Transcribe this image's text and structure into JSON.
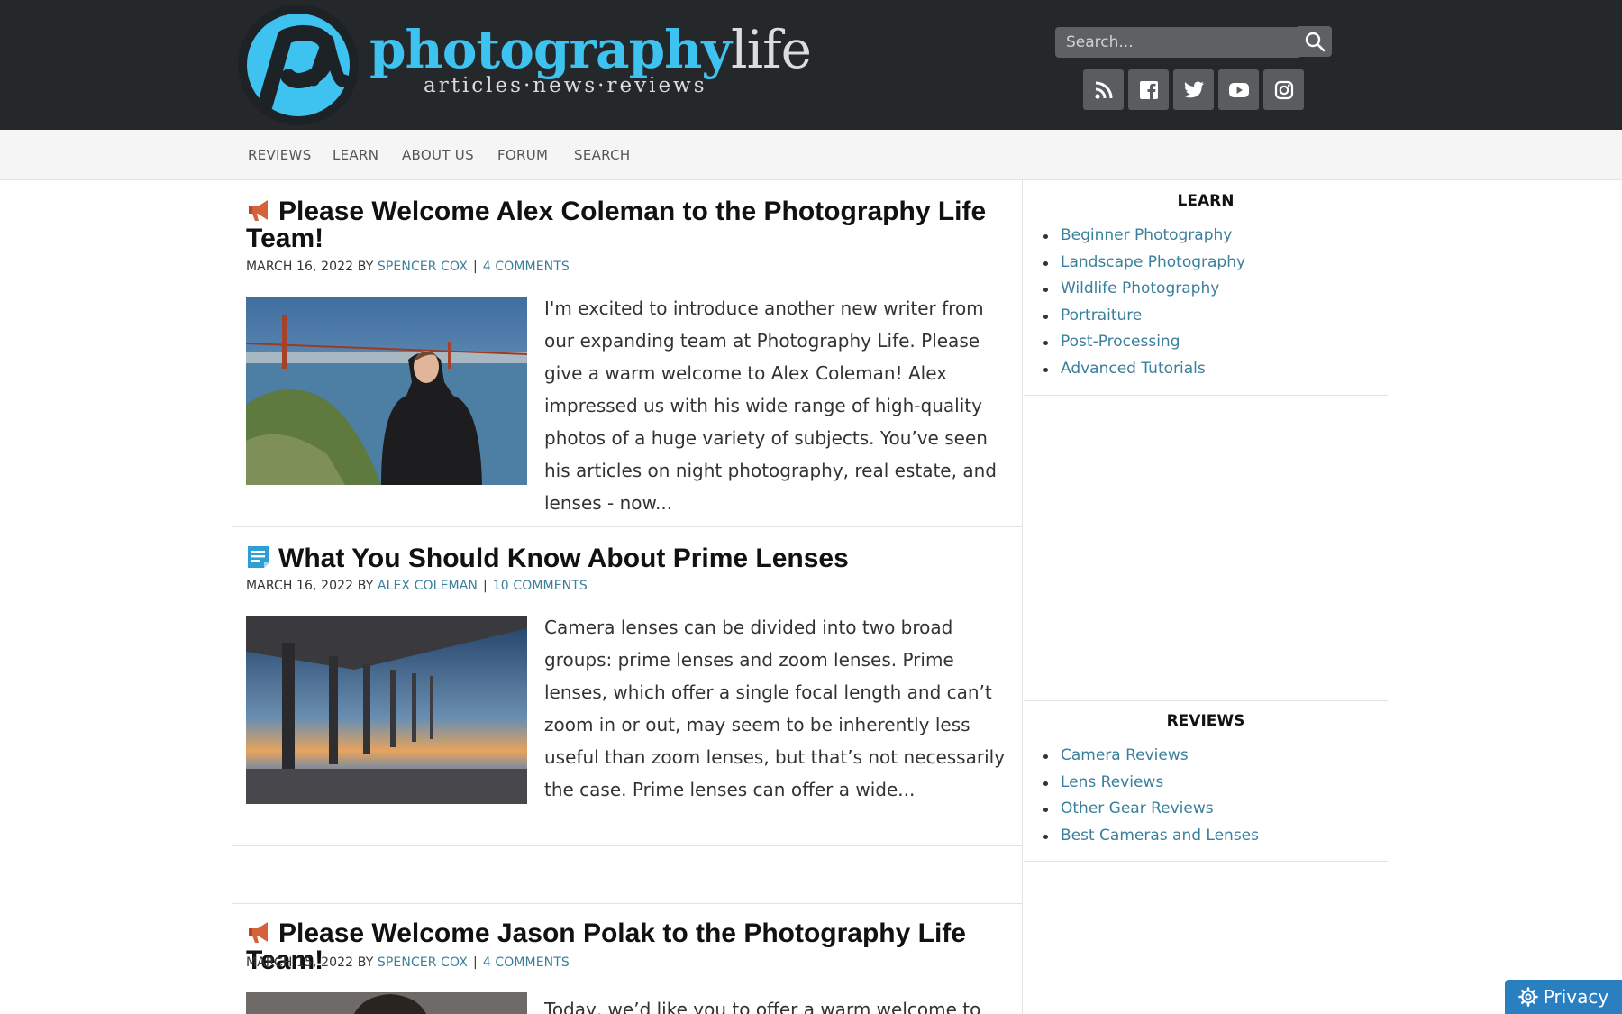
{
  "header": {
    "logo_word_1": "photography",
    "logo_word_2": "life",
    "logo_tagline": "articles·news·reviews",
    "search_placeholder": "Search...",
    "social_icons": [
      "rss-icon",
      "facebook-icon",
      "twitter-icon",
      "youtube-icon",
      "instagram-icon"
    ]
  },
  "nav": {
    "items": [
      "REVIEWS",
      "LEARN",
      "ABOUT US",
      "FORUM",
      "SEARCH"
    ]
  },
  "posts": [
    {
      "icon": "megaphone-icon",
      "title": "Please Welcome Alex Coleman to the Photography Life Team!",
      "date": "MARCH 16, 2022",
      "by": "BY",
      "author": "SPENCER COX",
      "comments": "4 COMMENTS",
      "excerpt": "I'm excited to introduce another new writer from our expanding team at Photography Life. Please give a warm welcome to Alex Coleman! Alex impressed us with his wide range of high-quality photos of a huge variety of subjects. You’ve seen his articles on night photography, real estate, and lenses - now..."
    },
    {
      "icon": "document-icon",
      "title": "What You Should Know About Prime Lenses",
      "date": "MARCH 16, 2022",
      "by": "BY",
      "author": "ALEX COLEMAN",
      "comments": "10 COMMENTS",
      "excerpt": "Camera lenses can be divided into two broad groups: prime lenses and zoom lenses. Prime lenses, which offer a single focal length and can’t zoom in or out, may seem to be inherently less useful than zoom lenses, but that’s not necessarily the case. Prime lenses can offer a wide..."
    },
    {
      "icon": "megaphone-icon",
      "title": "Please Welcome Jason Polak to the Photography Life Team!",
      "date": "MARCH 15, 2022",
      "by": "BY",
      "author": "SPENCER COX",
      "comments": "4 COMMENTS",
      "excerpt": "Today, we’d like you to offer a warm welcome to"
    }
  ],
  "sidebar": {
    "learn_heading": "LEARN",
    "learn_items": [
      "Beginner Photography",
      "Landscape Photography",
      "Wildlife Photography",
      "Portraiture",
      "Post-Processing",
      "Advanced Tutorials"
    ],
    "reviews_heading": "REVIEWS",
    "reviews_items": [
      "Camera Reviews",
      "Lens Reviews",
      "Other Gear Reviews",
      "Best Cameras and Lenses"
    ]
  },
  "privacy": {
    "label": "Privacy"
  },
  "colors": {
    "header_bg": "#25282b",
    "brand_blue": "#3ec3f0",
    "link": "#3a7f9c",
    "privacy_bg": "#2a7fc0"
  }
}
